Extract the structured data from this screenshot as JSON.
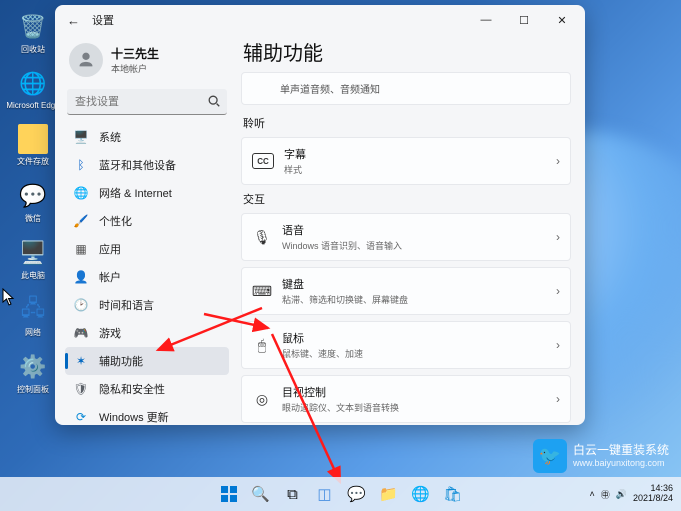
{
  "desktop": {
    "icons": [
      {
        "label": "回收站",
        "glyph": "🗑️"
      },
      {
        "label": "Microsoft Edge",
        "glyph": "🌐",
        "color": "#2aa7de"
      },
      {
        "label": "文件存放",
        "glyph": "📁",
        "color": "#ffd35a"
      },
      {
        "label": "微信",
        "glyph": "💬",
        "color": "#07c160"
      },
      {
        "label": "此电脑",
        "glyph": "🖥️",
        "color": "#2d7dd2"
      },
      {
        "label": "网络",
        "glyph": "🖧",
        "color": "#2d7dd2"
      },
      {
        "label": "控制面板",
        "glyph": "⚙️",
        "color": "#3b86d6"
      }
    ]
  },
  "window": {
    "title": "设置",
    "user": {
      "name": "十三先生",
      "sub": "本地帐户"
    },
    "search_placeholder": "查找设置",
    "sidebar": [
      {
        "icon": "🖥️",
        "label": "系统",
        "color": "#3a7bd5"
      },
      {
        "icon": "ᛒ",
        "label": "蓝牙和其他设备",
        "color": "#0a63c9"
      },
      {
        "icon": "🌐",
        "label": "网络 & Internet",
        "color": "#14853f"
      },
      {
        "icon": "🖌️",
        "label": "个性化",
        "color": "#c1532a"
      },
      {
        "icon": "▦",
        "label": "应用",
        "color": "#555"
      },
      {
        "icon": "👤",
        "label": "帐户",
        "color": "#b04a7a"
      },
      {
        "icon": "🕑",
        "label": "时间和语言",
        "color": "#2aa0c8"
      },
      {
        "icon": "🎮",
        "label": "游戏",
        "color": "#7aa22e"
      },
      {
        "icon": "✶",
        "label": "辅助功能",
        "color": "#0067c0",
        "active": true
      },
      {
        "icon": "🛡",
        "label": "隐私和安全性",
        "color": "#5a5f66"
      },
      {
        "icon": "⟳",
        "label": "Windows 更新",
        "color": "#0a8ad6"
      }
    ],
    "main": {
      "heading": "辅助功能",
      "partial_card_sub": "单声道音频、音频通知",
      "section_listen": "聆听",
      "cards_listen": [
        {
          "icon": "CC",
          "title": "字幕",
          "sub": "样式"
        }
      ],
      "section_interact": "交互",
      "cards_interact": [
        {
          "icon": "🎙",
          "title": "语音",
          "sub": "Windows 语音识别、语音输入"
        },
        {
          "icon": "⌨",
          "title": "键盘",
          "sub": "粘滞、筛选和切换键、屏幕键盘"
        },
        {
          "icon": "🖱",
          "title": "鼠标",
          "sub": "鼠标键、速度、加速"
        },
        {
          "icon": "◎",
          "title": "目视控制",
          "sub": "眼动追踪仪、文本到语音转换"
        }
      ]
    }
  },
  "watermark": {
    "title": "白云一键重装系统",
    "url": "www.baiyunxitong.com"
  },
  "tray": {
    "time": "14:36",
    "date": "2021/8/24"
  }
}
